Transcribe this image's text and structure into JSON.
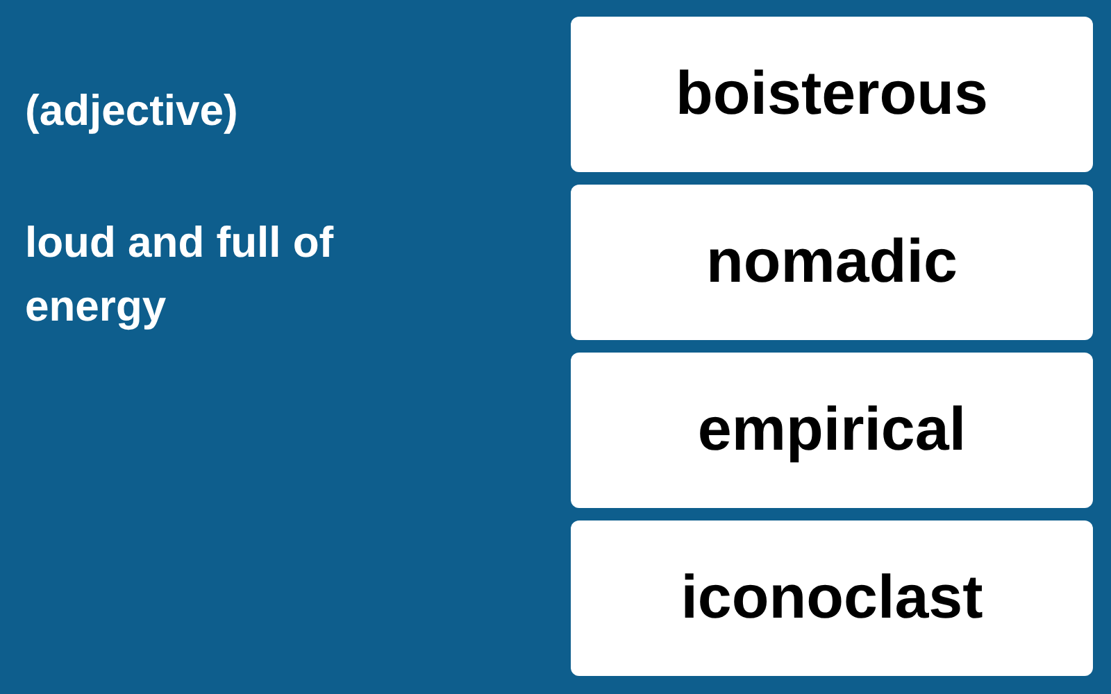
{
  "prompt": {
    "part_of_speech": "(adjective)",
    "definition": "loud and full of energy"
  },
  "choices": [
    {
      "label": "boisterous"
    },
    {
      "label": "nomadic"
    },
    {
      "label": "empirical"
    },
    {
      "label": "iconoclast"
    }
  ]
}
